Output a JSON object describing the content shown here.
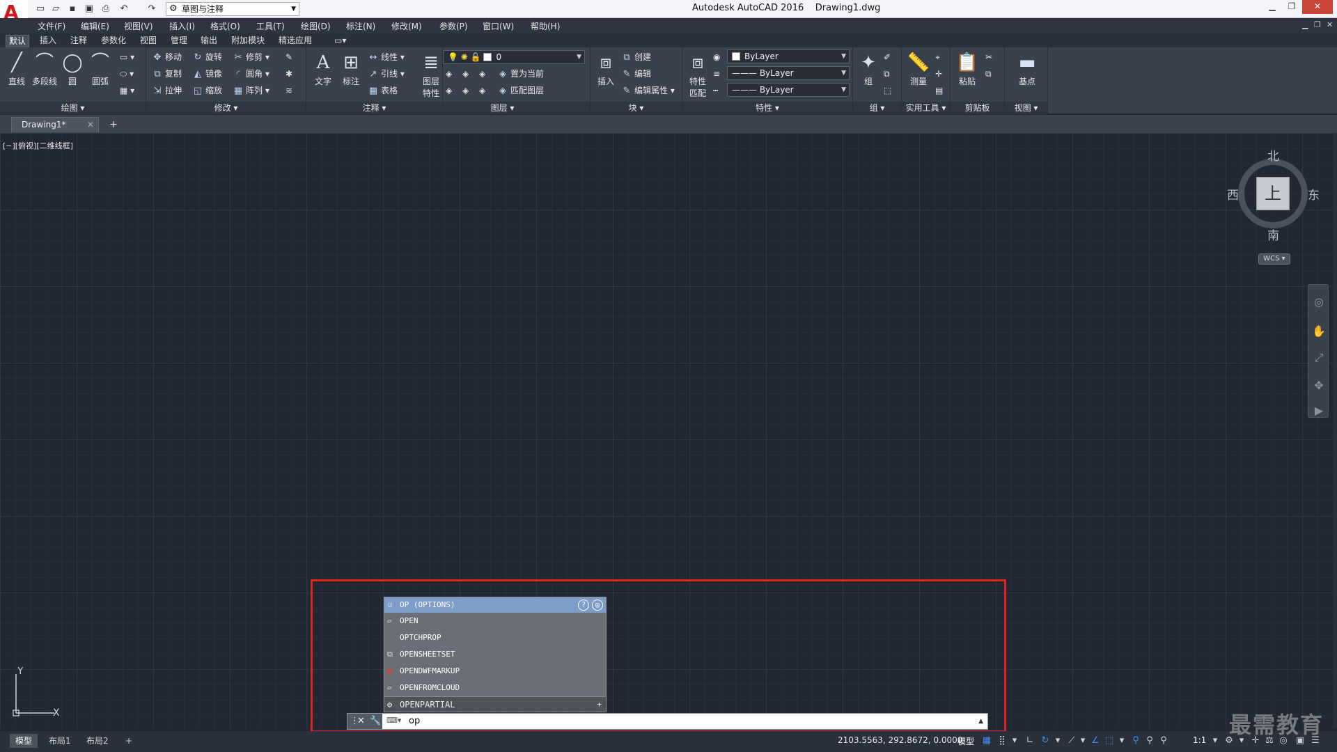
{
  "title_bar": {
    "app_title": "Autodesk AutoCAD 2016",
    "file_name": "Drawing1.dwg",
    "workspace": "草图与注释",
    "logo_icon": "autocad-a-logo-icon"
  },
  "menu": [
    "文件(F)",
    "编辑(E)",
    "视图(V)",
    "插入(I)",
    "格式(O)",
    "工具(T)",
    "绘图(D)",
    "标注(N)",
    "修改(M)",
    "参数(P)",
    "窗口(W)",
    "帮助(H)"
  ],
  "ribbon_tabs": [
    "默认",
    "插入",
    "注释",
    "参数化",
    "视图",
    "管理",
    "输出",
    "附加模块",
    "精选应用"
  ],
  "ribbon": {
    "draw": {
      "title": "绘图",
      "tools": [
        "直线",
        "多段线",
        "圆",
        "圆弧"
      ]
    },
    "modify": {
      "title": "修改",
      "tools": [
        "移动",
        "旋转",
        "修剪",
        "复制",
        "镜像",
        "圆角",
        "拉伸",
        "缩放",
        "阵列"
      ]
    },
    "annotation": {
      "title": "注释",
      "tools": [
        "文字",
        "标注",
        "线性",
        "引线",
        "表格"
      ]
    },
    "layers": {
      "title": "图层",
      "layer_props": "图层\n特性",
      "current_layer": "0",
      "tools": [
        "置为当前",
        "匹配图层"
      ],
      "label_line1": "图层",
      "label_line2": "特性"
    },
    "block": {
      "title": "块",
      "insert": "插入",
      "tools": [
        "创建",
        "编辑",
        "编辑属性"
      ]
    },
    "properties": {
      "title": "特性",
      "match_line1": "特性",
      "match_line2": "匹配",
      "color": "ByLayer",
      "linetype": "ByLayer",
      "lineweight": "ByLayer"
    },
    "groups": {
      "title": "组",
      "group": "组"
    },
    "utilities": {
      "title": "实用工具",
      "measure": "测量"
    },
    "clipboard": {
      "title": "剪贴板",
      "paste": "粘贴"
    },
    "view": {
      "title": "视图",
      "base": "基点"
    }
  },
  "doc_tab": {
    "label": "Drawing1*"
  },
  "viewport_label": "[−][俯视][二维线框]",
  "viewcube": {
    "north": "北",
    "south": "南",
    "east": "东",
    "west": "西",
    "face": "上",
    "wcs": "WCS"
  },
  "autocomplete": {
    "header": "OP (OPTIONS)",
    "items": [
      "OPEN",
      "OPTCHPROP",
      "OPENSHEETSET",
      "OPENDWFMARKUP",
      "OPENFROMCLOUD"
    ],
    "last": "OPENPARTIAL"
  },
  "command": {
    "input": "op"
  },
  "layout_tabs": [
    "模型",
    "布局1",
    "布局2"
  ],
  "status": {
    "coords": "2103.5563, 292.8672, 0.0000",
    "model": "模型",
    "scale": "1:1"
  },
  "watermark": "最需教育",
  "ucs": {
    "x": "X",
    "y": "Y"
  },
  "colors": {
    "canvas": "#212833",
    "highlight": "#e0231b",
    "ac_header": "#7d9cc8"
  }
}
